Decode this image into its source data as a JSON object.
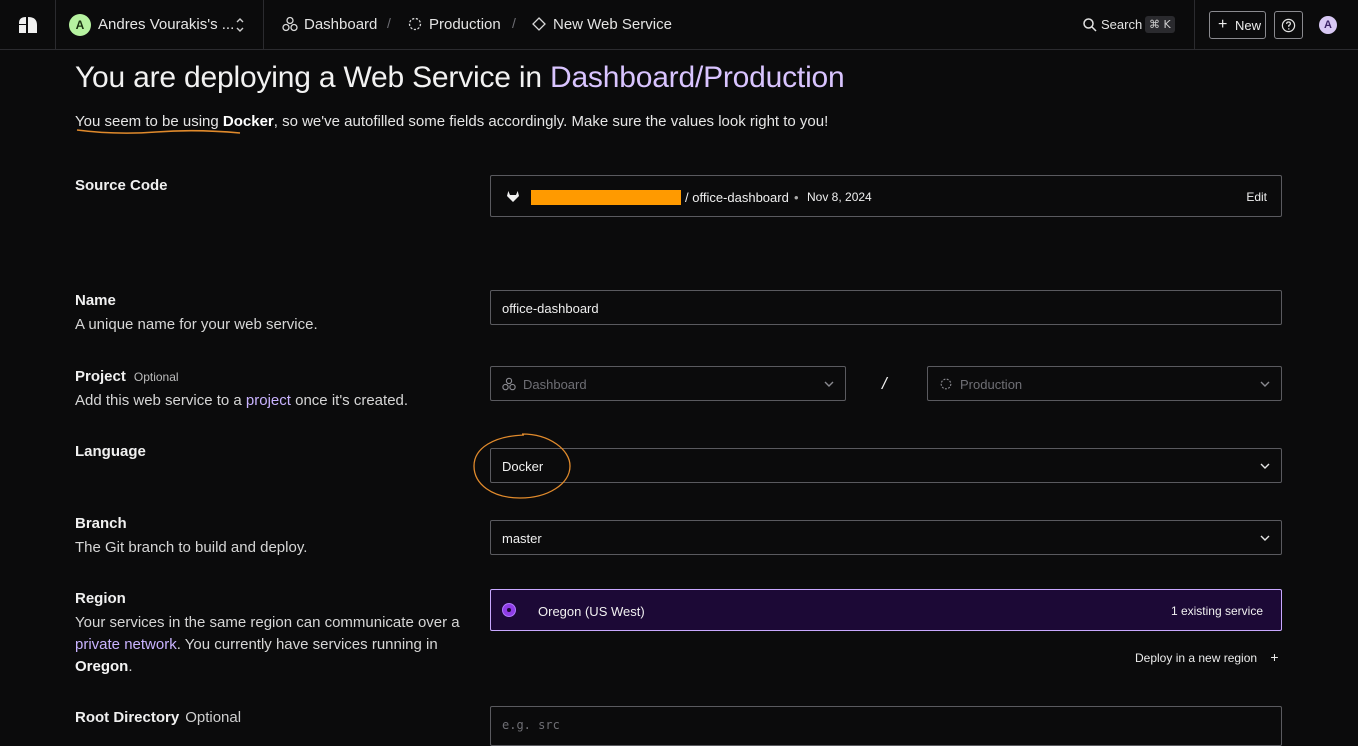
{
  "nav": {
    "workspace_initial": "A",
    "workspace_name": "Andres Vourakis's ...",
    "crumbs": [
      "Dashboard",
      "Production",
      "New Web Service"
    ],
    "crumb_sep": "/",
    "search_label": "Search",
    "search_shortcut": "⌘ K",
    "new_label": "New",
    "user_initial": "A"
  },
  "header": {
    "title_prefix": "You are deploying a Web Service in ",
    "title_accent": "Dashboard/Production",
    "sub_part1": "You seem to be using ",
    "sub_bold": "Docker",
    "sub_part2": ", so we've autofilled some fields accordingly. Make sure the values look right to you!"
  },
  "source": {
    "label": "Source Code",
    "repo": "/ office-dashboard",
    "dot": "•",
    "date": "Nov 8, 2024",
    "edit_label": "Edit"
  },
  "name": {
    "label": "Name",
    "desc": "A unique name for your web service.",
    "value": "office-dashboard"
  },
  "project": {
    "label": "Project",
    "optional": "Optional",
    "desc_part1": "Add this web service to a ",
    "desc_link": "project",
    "desc_part2": " once it's created.",
    "project_placeholder": "Dashboard",
    "separator": "/",
    "env_placeholder": "Production"
  },
  "language": {
    "label": "Language",
    "value": "Docker"
  },
  "branch": {
    "label": "Branch",
    "desc": "The Git branch to build and deploy.",
    "value": "master"
  },
  "region": {
    "label": "Region",
    "desc_line1": "Your services in the same region can communicate over a",
    "desc_link": "private network",
    "desc_line2_rest": ". You currently have services running in",
    "desc_line3": "Oregon",
    "desc_line3_end": ".",
    "value": "Oregon (US West)",
    "existing": "1 existing service",
    "deploy_new": "Deploy in a new region",
    "deploy_new_icon": "+"
  },
  "root": {
    "label": "Root Directory",
    "optional": "Optional",
    "placeholder": "e.g. src"
  },
  "colors": {
    "accent": "#d9c4ff",
    "region_bg": "#1c0936",
    "annotation": "#e08a2c",
    "redaction": "#ff9a00"
  }
}
